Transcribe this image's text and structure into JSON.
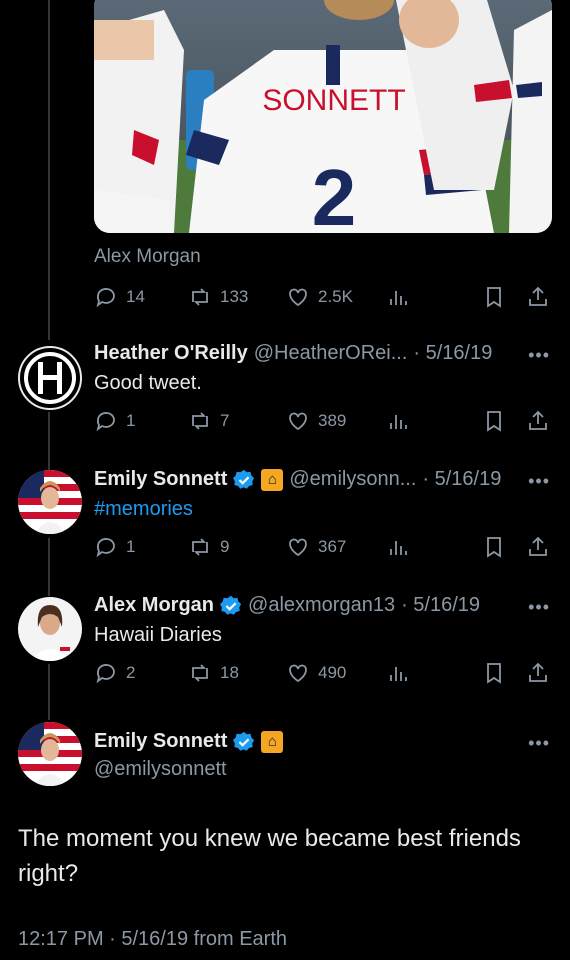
{
  "media": {
    "caption": "Alex Morgan",
    "jersey_name": "SONNETT",
    "jersey_number": "2"
  },
  "stats_top": {
    "replies": "14",
    "retweets": "133",
    "likes": "2.5K"
  },
  "tweets": [
    {
      "name": "Heather O'Reilly",
      "handle": "@HeatherORei...",
      "date": "· 5/16/19",
      "text": "Good tweet.",
      "replies": "1",
      "retweets": "7",
      "likes": "389"
    },
    {
      "name": "Emily Sonnett",
      "handle": "@emilysonn...",
      "date": "· 5/16/19",
      "text": "#memories",
      "replies": "1",
      "retweets": "9",
      "likes": "367"
    },
    {
      "name": "Alex Morgan",
      "handle": "@alexmorgan13",
      "date": "· 5/16/19",
      "text": "Hawaii Diaries",
      "replies": "2",
      "retweets": "18",
      "likes": "490"
    }
  ],
  "main_tweet": {
    "name": "Emily Sonnett",
    "handle": "@emilysonnett",
    "text_line1": "The moment you knew we became best friends",
    "text_line2": "right?",
    "meta": "12:17 PM · 5/16/19 from Earth"
  },
  "more_label": "•••",
  "colors": {
    "background": "#000000",
    "text": "#e7e9ea",
    "muted": "#8b98a5",
    "link": "#1d9bf0",
    "verified": "#1d9bf0"
  }
}
